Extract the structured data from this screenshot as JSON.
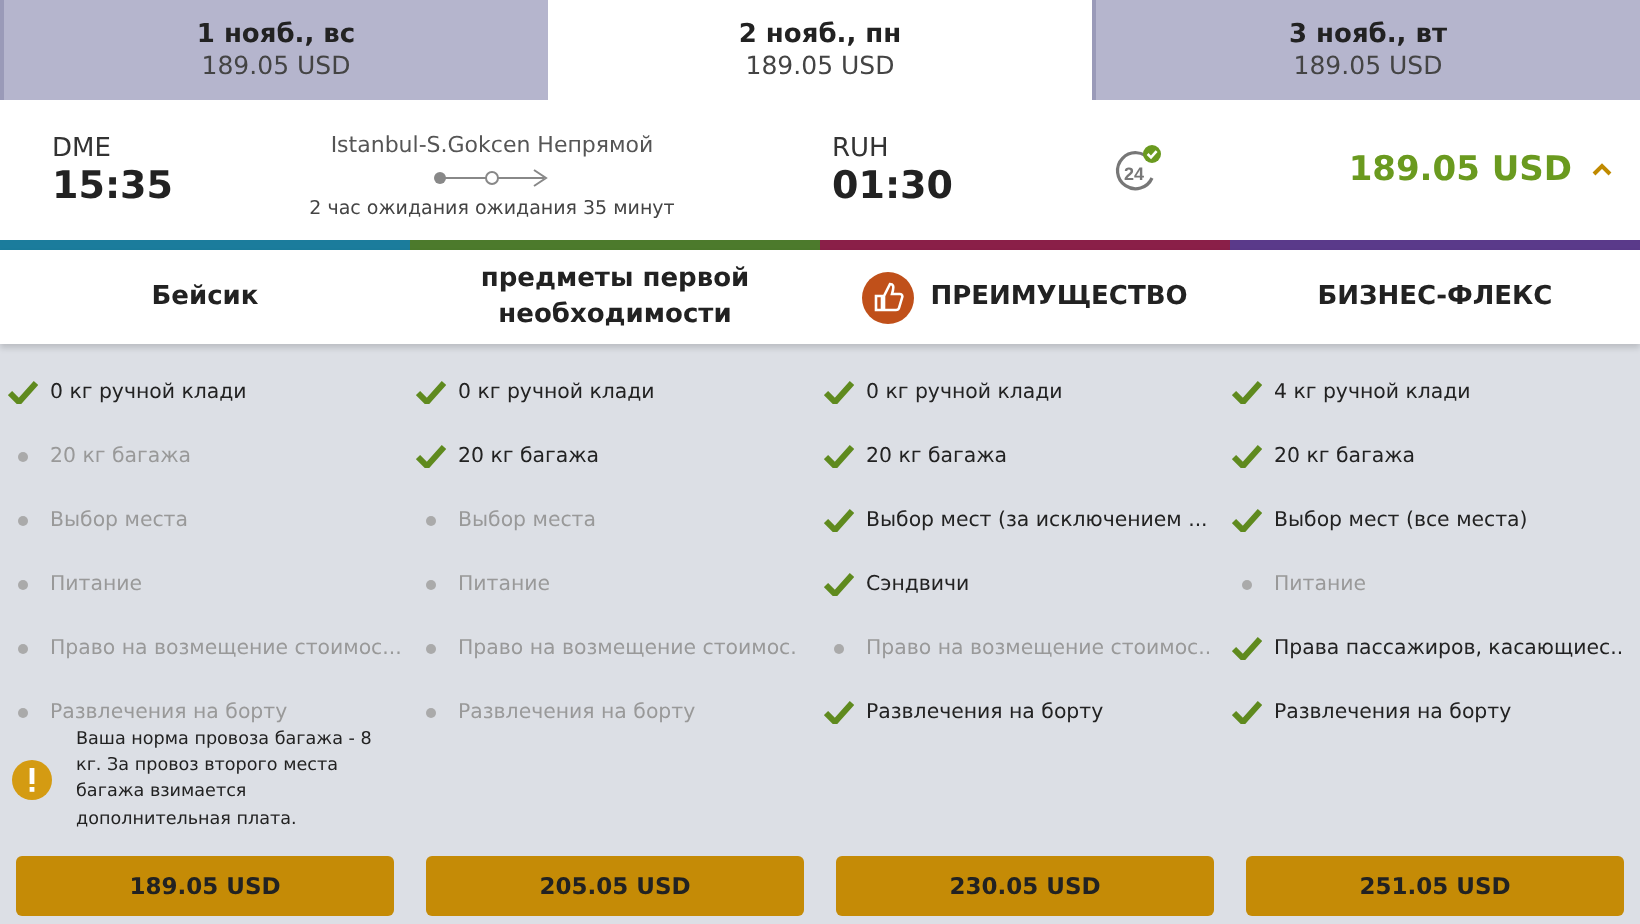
{
  "date_tabs": [
    {
      "date": "1 нояб., вс",
      "price": "189.05 USD",
      "selected": false
    },
    {
      "date": "2 нояб., пн",
      "price": "189.05 USD",
      "selected": true
    },
    {
      "date": "3 нояб., вт",
      "price": "189.05 USD",
      "selected": false
    }
  ],
  "flight": {
    "origin": "DME",
    "departure": "15:35",
    "route": "Istanbul-S.Gokcen Непрямой",
    "layover": "2 час ожидания ожидания 35 минут",
    "destination": "RUH",
    "arrival": "01:30",
    "price": "189.05 USD",
    "expanded": true,
    "service_badge": "24"
  },
  "fares": [
    {
      "name": "Бейсик",
      "color": "#1b7c9c",
      "recommended": false,
      "features": [
        {
          "text": "0 кг ручной клади",
          "included": true
        },
        {
          "text": "20 кг багажа",
          "included": false
        },
        {
          "text": "Выбор места",
          "included": false
        },
        {
          "text": "Питание",
          "included": false
        },
        {
          "text": "Право на возмещение стоимос...",
          "included": false
        },
        {
          "text": "Развлечения на борту",
          "included": false
        }
      ],
      "notice": "Ваша норма провоза багажа - 8 кг. За провоз второго места багажа взимается дополнительная плата.",
      "price": "189.05 USD"
    },
    {
      "name": "предметы первой необходимости",
      "color": "#4c7a2c",
      "recommended": false,
      "features": [
        {
          "text": "0 кг ручной клади",
          "included": true
        },
        {
          "text": "20 кг багажа",
          "included": true
        },
        {
          "text": "Выбор места",
          "included": false
        },
        {
          "text": "Питание",
          "included": false
        },
        {
          "text": "Право на возмещение стоимос.",
          "included": false
        },
        {
          "text": "Развлечения на борту",
          "included": false
        }
      ],
      "price": "205.05 USD"
    },
    {
      "name": "ПРЕИМУЩЕСТВО",
      "color": "#8a1f48",
      "recommended": true,
      "features": [
        {
          "text": "0 кг ручной клади",
          "included": true
        },
        {
          "text": "20 кг багажа",
          "included": true
        },
        {
          "text": "Выбор мест (за исключением ...",
          "included": true
        },
        {
          "text": "Сэндвичи",
          "included": true
        },
        {
          "text": "Право на возмещение стоимос..",
          "included": false
        },
        {
          "text": "Развлечения на борту",
          "included": true
        }
      ],
      "price": "230.05 USD"
    },
    {
      "name": "БИЗНЕС-ФЛЕКС",
      "color": "#5a3a8a",
      "recommended": false,
      "features": [
        {
          "text": "4 кг ручной клади",
          "included": true
        },
        {
          "text": "20 кг багажа",
          "included": true
        },
        {
          "text": "Выбор мест (все места)",
          "included": true
        },
        {
          "text": "Питание",
          "included": false
        },
        {
          "text": "Права пассажиров, касающиес..",
          "included": true
        },
        {
          "text": "Развлечения на борту",
          "included": true
        }
      ],
      "price": "251.05 USD"
    }
  ]
}
